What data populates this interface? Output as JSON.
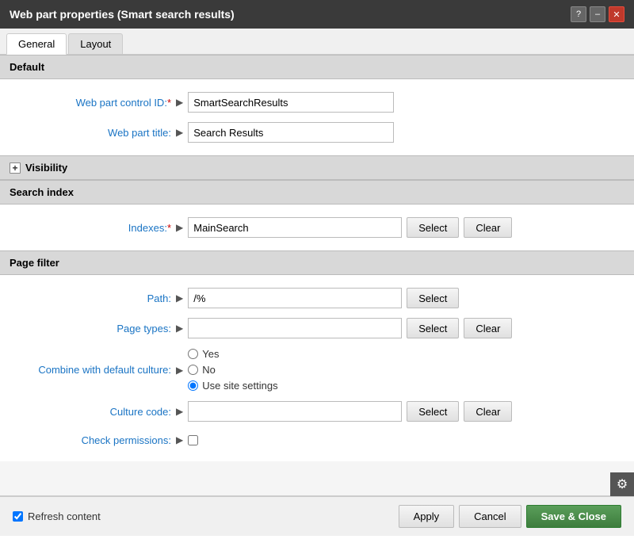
{
  "titleBar": {
    "title": "Web part properties (Smart search results)",
    "helpBtn": "?",
    "minBtn": "–",
    "closeBtn": "✕"
  },
  "tabs": [
    {
      "label": "General",
      "active": true
    },
    {
      "label": "Layout",
      "active": false
    }
  ],
  "sections": {
    "default": {
      "label": "Default",
      "fields": {
        "controlId": {
          "label": "Web part control ID:",
          "required": true,
          "value": "SmartSearchResults"
        },
        "title": {
          "label": "Web part title:",
          "value": "Search Results"
        }
      }
    },
    "visibility": {
      "label": "Visibility"
    },
    "searchIndex": {
      "label": "Search index",
      "fields": {
        "indexes": {
          "label": "Indexes:",
          "required": true,
          "value": "MainSearch"
        }
      }
    },
    "pageFilter": {
      "label": "Page filter",
      "fields": {
        "path": {
          "label": "Path:",
          "value": "/%"
        },
        "pageTypes": {
          "label": "Page types:",
          "value": ""
        },
        "combineWithDefault": {
          "label": "Combine with default culture:",
          "options": [
            {
              "label": "Yes",
              "checked": false
            },
            {
              "label": "No",
              "checked": false
            },
            {
              "label": "Use site settings",
              "checked": true
            }
          ]
        },
        "cultureCode": {
          "label": "Culture code:",
          "value": ""
        },
        "checkPermissions": {
          "label": "Check permissions:",
          "checked": false
        }
      }
    }
  },
  "buttons": {
    "select": "Select",
    "clear": "Clear",
    "apply": "Apply",
    "cancel": "Cancel",
    "saveClose": "Save & Close"
  },
  "bottomBar": {
    "refreshLabel": "Refresh content",
    "refreshChecked": true
  }
}
